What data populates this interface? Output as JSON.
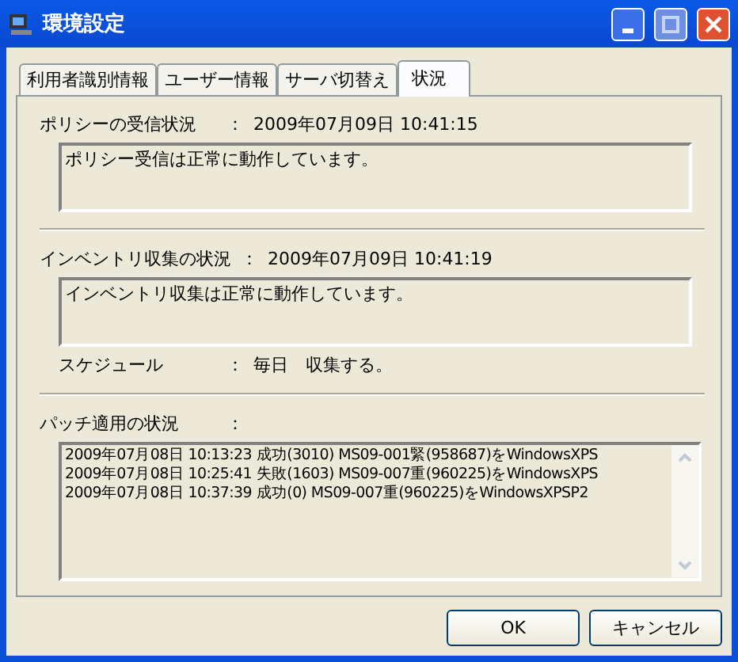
{
  "window": {
    "title": "環境設定"
  },
  "tabs": [
    {
      "label": "利用者識別情報",
      "selected": false
    },
    {
      "label": "ユーザー情報",
      "selected": false
    },
    {
      "label": "サーバ切替え",
      "selected": false
    },
    {
      "label": "状況",
      "selected": true
    }
  ],
  "policy": {
    "label": "ポリシーの受信状況",
    "colon": "：",
    "time": "2009年07月09日 10:41:15",
    "message": "ポリシー受信は正常に動作しています。"
  },
  "inventory": {
    "label": "インベントリ収集の状況",
    "colon": "：",
    "time": "2009年07月09日 10:41:19",
    "message": "インベントリ収集は正常に動作しています。",
    "schedule_label": "スケジュール",
    "schedule_colon": "：",
    "schedule_value": "毎日　収集する。"
  },
  "patch": {
    "label": "パッチ適用の状況",
    "colon": "：",
    "log": [
      "2009年07月08日 10:13:23 成功(3010) MS09-001緊(958687)をWindowsXPS",
      "2009年07月08日 10:25:41 失敗(1603) MS09-007重(960225)をWindowsXPS",
      "2009年07月08日 10:37:39 成功(0) MS09-007重(960225)をWindowsXPSP2"
    ]
  },
  "buttons": [
    "OK",
    "キャンセル"
  ]
}
